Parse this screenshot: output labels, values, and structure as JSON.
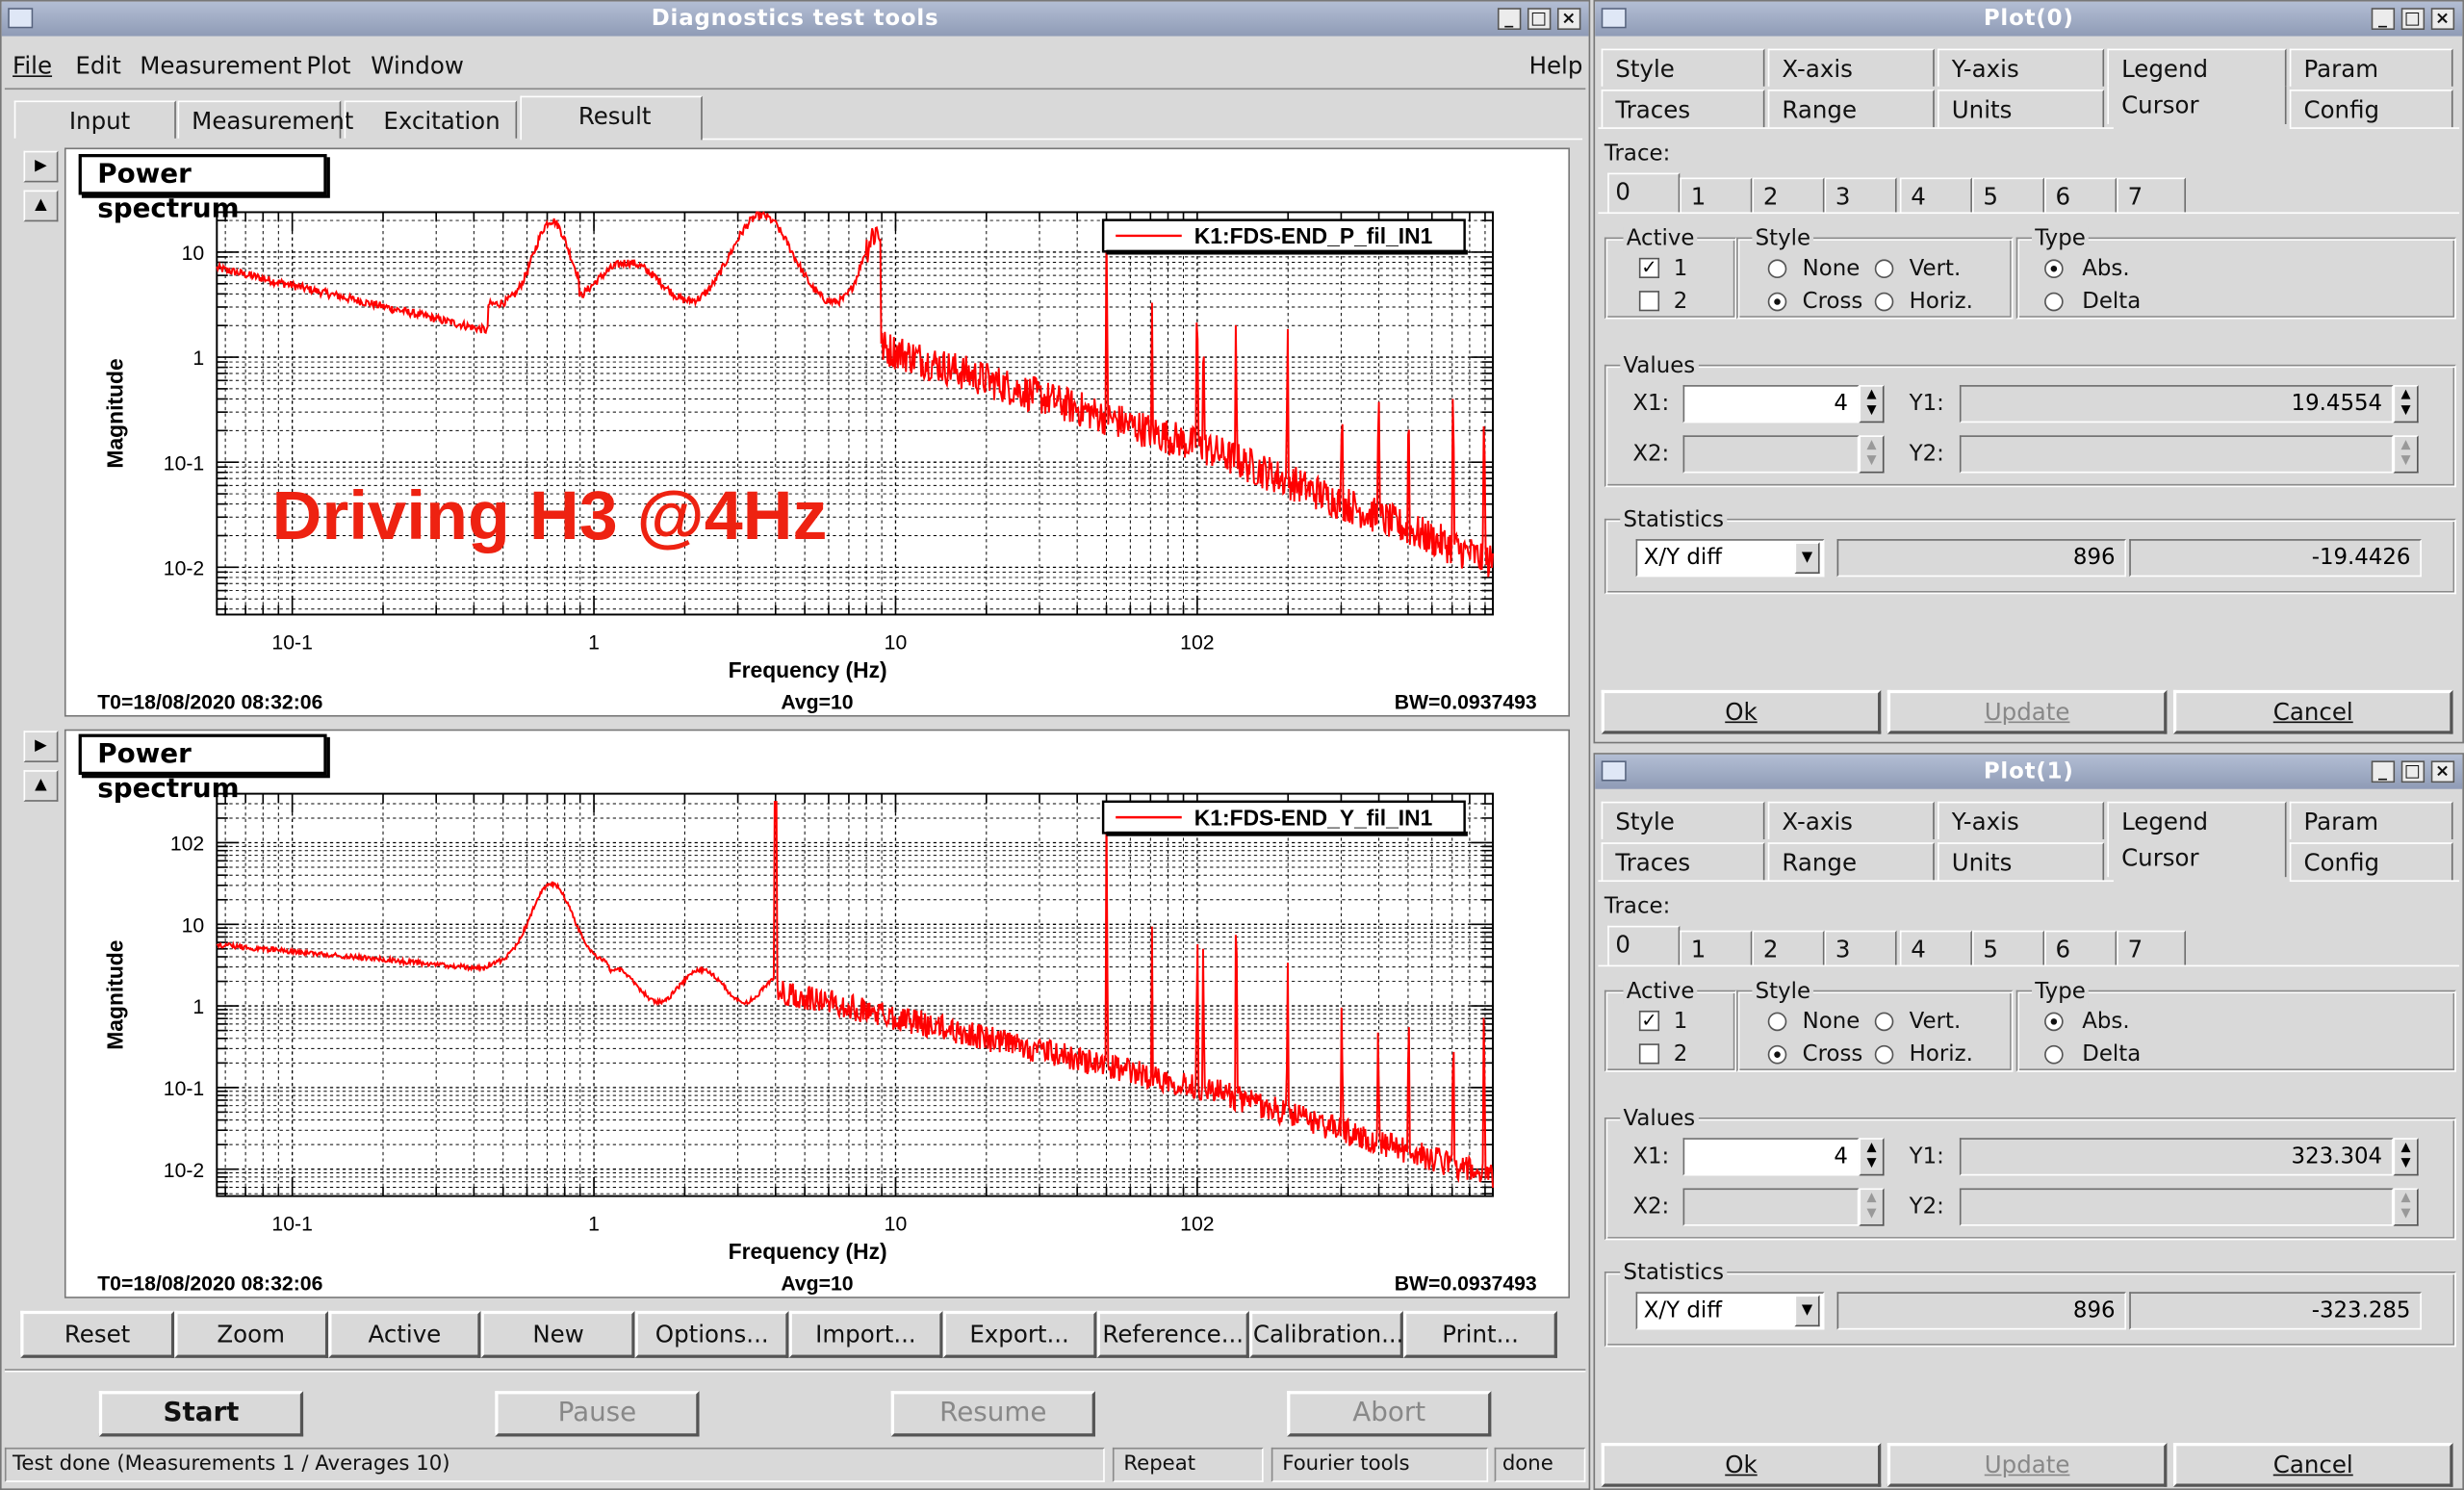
{
  "main": {
    "title": "Diagnostics test tools",
    "menu": [
      "File",
      "Edit",
      "Measurement",
      "Plot",
      "Window"
    ],
    "help": "Help",
    "tabs": [
      "Input",
      "Measurement",
      "Excitation",
      "Result"
    ],
    "active_tab": "Result",
    "overlay_text": "Driving H3 @4Hz",
    "plots": [
      {
        "panel_title": "Power spectrum",
        "legend": "K1:FDS-END_P_fil_IN1",
        "ylabel": "Magnitude",
        "xlabel": "Frequency (Hz)",
        "x_ticks": [
          "10-1",
          "1",
          "10",
          "102"
        ],
        "y_ticks": [
          "10",
          "1",
          "10-1",
          "10-2"
        ],
        "t0": "T0=18/08/2020 08:32:06",
        "avg": "Avg=10",
        "bw": "BW=0.0937493"
      },
      {
        "panel_title": "Power spectrum",
        "legend": "K1:FDS-END_Y_fil_IN1",
        "ylabel": "Magnitude",
        "xlabel": "Frequency (Hz)",
        "x_ticks": [
          "10-1",
          "1",
          "10",
          "102"
        ],
        "y_ticks": [
          "102",
          "10",
          "1",
          "10-1",
          "10-2"
        ],
        "t0": "T0=18/08/2020 08:32:06",
        "avg": "Avg=10",
        "bw": "BW=0.0937493"
      }
    ],
    "toolbar": [
      "Reset",
      "Zoom",
      "Active",
      "New",
      "Options...",
      "Import...",
      "Export...",
      "Reference...",
      "Calibration...",
      "Print..."
    ],
    "controls": [
      "Start",
      "Pause",
      "Resume",
      "Abort"
    ],
    "status": {
      "message": "Test done (Measurements 1 / Averages 10)",
      "repeat": "Repeat",
      "fourier": "Fourier tools",
      "state": "done"
    }
  },
  "dialogs": [
    {
      "title": "Plot(0)",
      "tabs_row1": [
        "Style",
        "X-axis",
        "Y-axis",
        "Legend",
        "Param"
      ],
      "tabs_row2": [
        "Traces",
        "Range",
        "Units",
        "Cursor",
        "Config"
      ],
      "trace_label": "Trace:",
      "traces": [
        "0",
        "1",
        "2",
        "3",
        "4",
        "5",
        "6",
        "7"
      ],
      "active_label": "Active",
      "active_items": [
        "1",
        "2"
      ],
      "style_label": "Style",
      "style_items": [
        "None",
        "Vert.",
        "Cross",
        "Horiz."
      ],
      "type_label": "Type",
      "type_items": [
        "Abs.",
        "Delta"
      ],
      "values_label": "Values",
      "x1_label": "X1:",
      "x1": "4",
      "y1_label": "Y1:",
      "y1": "19.4554",
      "x2_label": "X2:",
      "y2_label": "Y2:",
      "statistics_label": "Statistics",
      "stat_mode": "X/Y diff",
      "stat_a": "896",
      "stat_b": "-19.4426",
      "buttons": [
        "Ok",
        "Update",
        "Cancel"
      ]
    },
    {
      "title": "Plot(1)",
      "tabs_row1": [
        "Style",
        "X-axis",
        "Y-axis",
        "Legend",
        "Param"
      ],
      "tabs_row2": [
        "Traces",
        "Range",
        "Units",
        "Cursor",
        "Config"
      ],
      "trace_label": "Trace:",
      "traces": [
        "0",
        "1",
        "2",
        "3",
        "4",
        "5",
        "6",
        "7"
      ],
      "active_label": "Active",
      "active_items": [
        "1",
        "2"
      ],
      "style_label": "Style",
      "style_items": [
        "None",
        "Vert.",
        "Cross",
        "Horiz."
      ],
      "type_label": "Type",
      "type_items": [
        "Abs.",
        "Delta"
      ],
      "values_label": "Values",
      "x1_label": "X1:",
      "x1": "4",
      "y1_label": "Y1:",
      "y1": "323.304",
      "x2_label": "X2:",
      "y2_label": "Y2:",
      "statistics_label": "Statistics",
      "stat_mode": "X/Y diff",
      "stat_a": "896",
      "stat_b": "-323.285",
      "buttons": [
        "Ok",
        "Update",
        "Cancel"
      ]
    }
  ],
  "colors": {
    "trace": "#ff0000",
    "overlay": "#ee2211",
    "titlebar": "#97a3bd"
  }
}
